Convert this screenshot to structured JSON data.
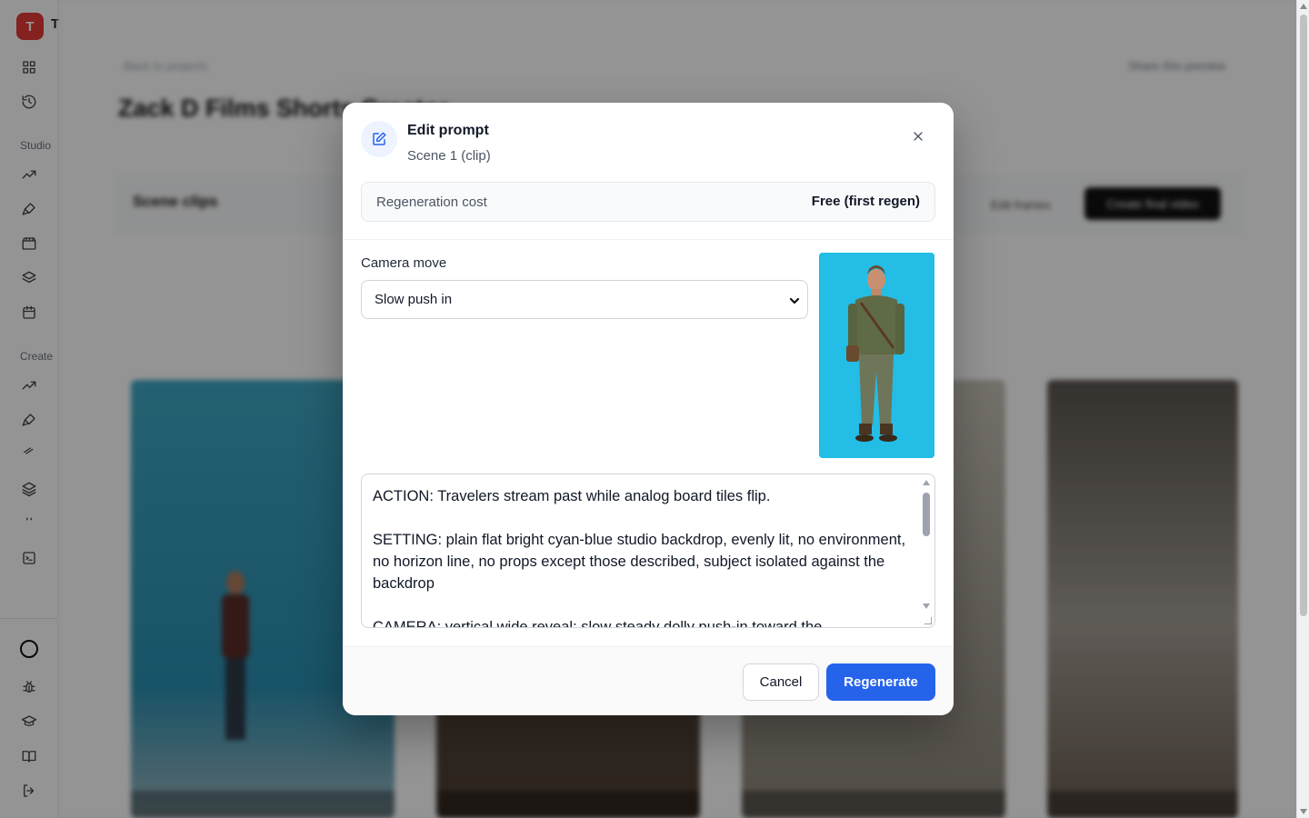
{
  "app": {
    "logo_letter": "T",
    "logo_text": "T"
  },
  "sidebar": {
    "section_studio": "Studio",
    "section_create": "Create",
    "icons": [
      "grid-icon",
      "history-icon",
      "trending-icon",
      "brush-icon",
      "clapperboard-icon",
      "layers-icon",
      "calendar-icon",
      "trending-icon",
      "brush-icon",
      "link-icon",
      "layers-icon",
      "more-icon",
      "terminal-icon",
      "circle-icon",
      "bug-icon",
      "graduation-cap-icon",
      "book-icon",
      "logout-icon"
    ]
  },
  "background": {
    "back_link": "Back to projects",
    "project_title": "Zack D Films Shorts Creator",
    "share_link": "Share this preview",
    "scene_heading": "Scene clips",
    "edit_frames": "Edit frames",
    "create_final": "Create final video"
  },
  "modal": {
    "title": "Edit prompt",
    "subtitle": "Scene 1 (clip)",
    "cost_label": "Regeneration cost",
    "cost_value": "Free (first regen)",
    "camera_label": "Camera move",
    "camera_value": "Slow push in",
    "camera_options": [
      "Slow push in"
    ],
    "prompt_text": "ACTION: Travelers stream past while analog board tiles flip.\n\nSETTING: plain flat bright cyan-blue studio backdrop, evenly lit, no environment, no horizon line, no props except those described, subject isolated against the backdrop\n\nCAMERA: vertical wide reveal; slow steady dolly push-in toward the",
    "cancel_label": "Cancel",
    "regenerate_label": "Regenerate"
  },
  "colors": {
    "accent": "#2563eb",
    "logo_bg": "#e53935",
    "thumb_bg": "#23bde6"
  }
}
